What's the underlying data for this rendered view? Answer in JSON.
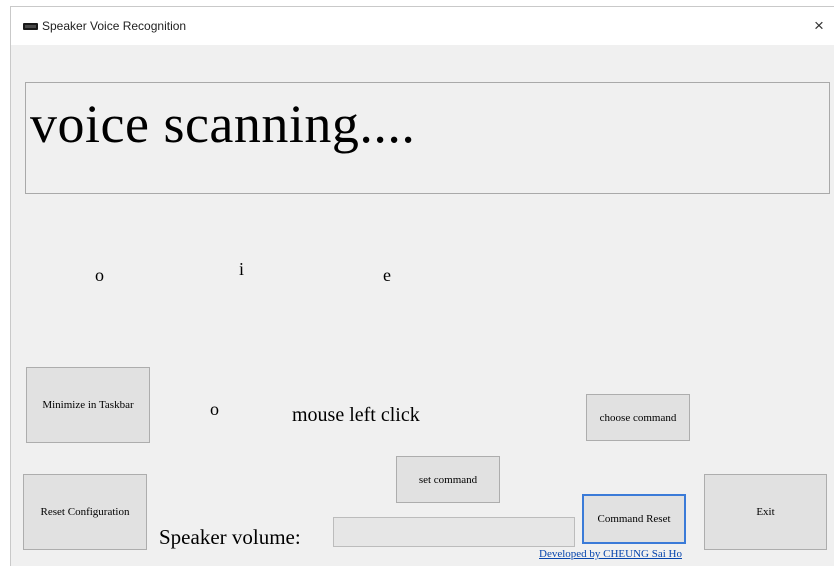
{
  "window": {
    "title": "Speaker Voice Recognition",
    "close_glyph": "×",
    "app_icon": "keyboard-icon"
  },
  "status": {
    "text": "voice scanning...."
  },
  "phonemes": [
    "o",
    "i",
    "e"
  ],
  "command_row": {
    "letter": "o",
    "action": "mouse left click"
  },
  "buttons": {
    "minimize": "Minimize in Taskbar",
    "choose_command": "choose command",
    "set_command": "set command",
    "reset_configuration": "Reset Configuration",
    "command_reset": "Command Reset",
    "exit": "Exit"
  },
  "volume": {
    "label": "Speaker volume:",
    "level": 0
  },
  "footer": {
    "credit": "Developed by CHEUNG Sai Ho"
  },
  "colors": {
    "focus_border": "#3b7bd8",
    "link": "#0645ad",
    "background": "#f0f0f0"
  }
}
